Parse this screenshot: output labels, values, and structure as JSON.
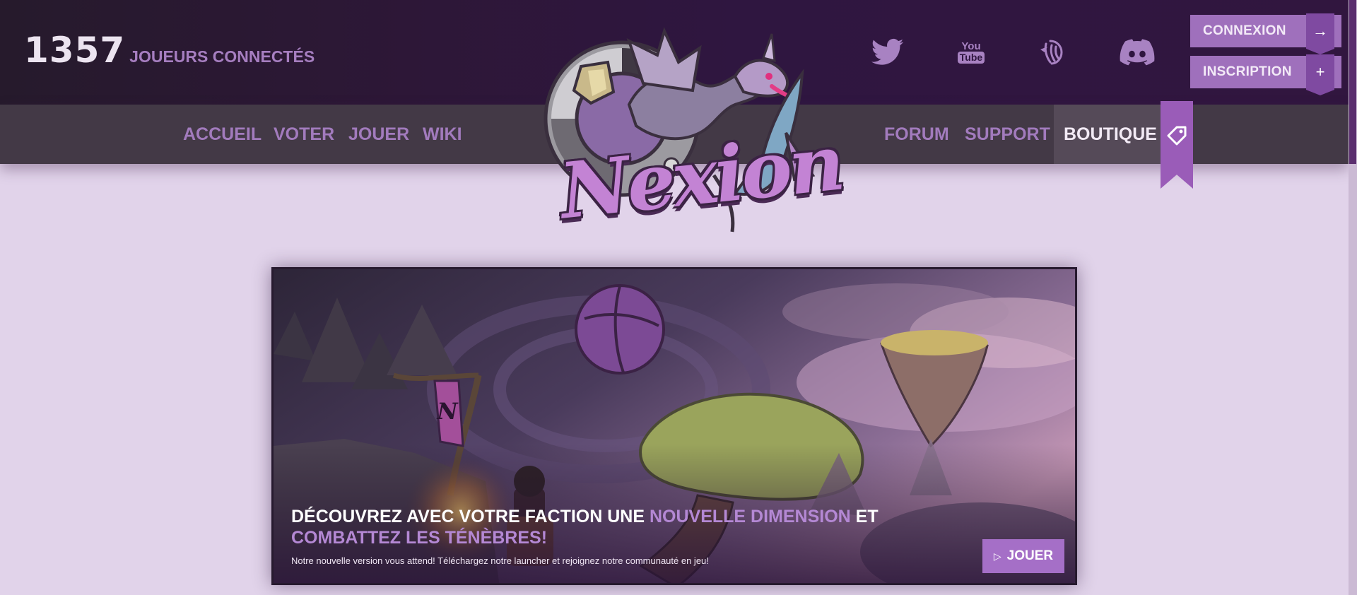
{
  "header": {
    "player_count": "1357",
    "player_label": "JOUEURS CONNECTÉS",
    "social": [
      {
        "icon": "twitter-icon"
      },
      {
        "icon": "youtube-icon",
        "text_top": "You",
        "text_bottom": "Tube"
      },
      {
        "icon": "curseforge-icon"
      },
      {
        "icon": "discord-icon"
      }
    ],
    "connexion_label": "CONNEXION",
    "connexion_icon": "→",
    "inscription_label": "INSCRIPTION",
    "inscription_icon": "+"
  },
  "nav": {
    "left": [
      "ACCUEIL",
      "VOTER",
      "JOUER",
      "WIKI"
    ],
    "right": [
      "FORUM",
      "SUPPORT",
      "BOUTIQUE"
    ],
    "active": "BOUTIQUE"
  },
  "logo": {
    "text": "Nexion"
  },
  "hero": {
    "title_part1": "DÉCOUVREZ AVEC VOTRE FACTION UNE ",
    "title_highlight1": "NOUVELLE DIMENSION",
    "title_part2": " ET ",
    "title_highlight2": "COMBATTEZ LES TÉNÈBRES!",
    "subtitle": "Notre nouvelle version vous attend! Téléchargez notre launcher et rejoignez notre communauté en jeu!",
    "button_label": "JOUER",
    "button_icon": "▷"
  },
  "colors": {
    "accent": "#a56fc7",
    "header_bg": "#2f1640",
    "nav_bg": "#433946",
    "page_bg": "#e1d3ea"
  }
}
